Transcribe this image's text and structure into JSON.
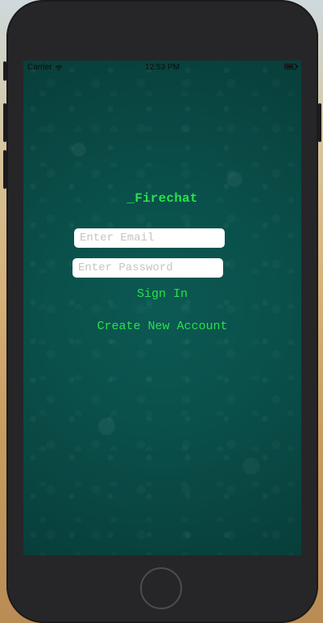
{
  "status_bar": {
    "carrier": "Carrier",
    "time": "12:53 PM"
  },
  "app": {
    "title": "_Firechat"
  },
  "login": {
    "email_placeholder": "Enter Email",
    "password_placeholder": "Enter Password",
    "sign_in_label": "Sign In",
    "create_account_label": "Create New Account"
  },
  "theme": {
    "background": "#0a4f4a",
    "accent_green": "#27e24a"
  },
  "icons": {
    "wifi": "wifi-icon",
    "battery": "battery-icon",
    "home": "home-button"
  }
}
